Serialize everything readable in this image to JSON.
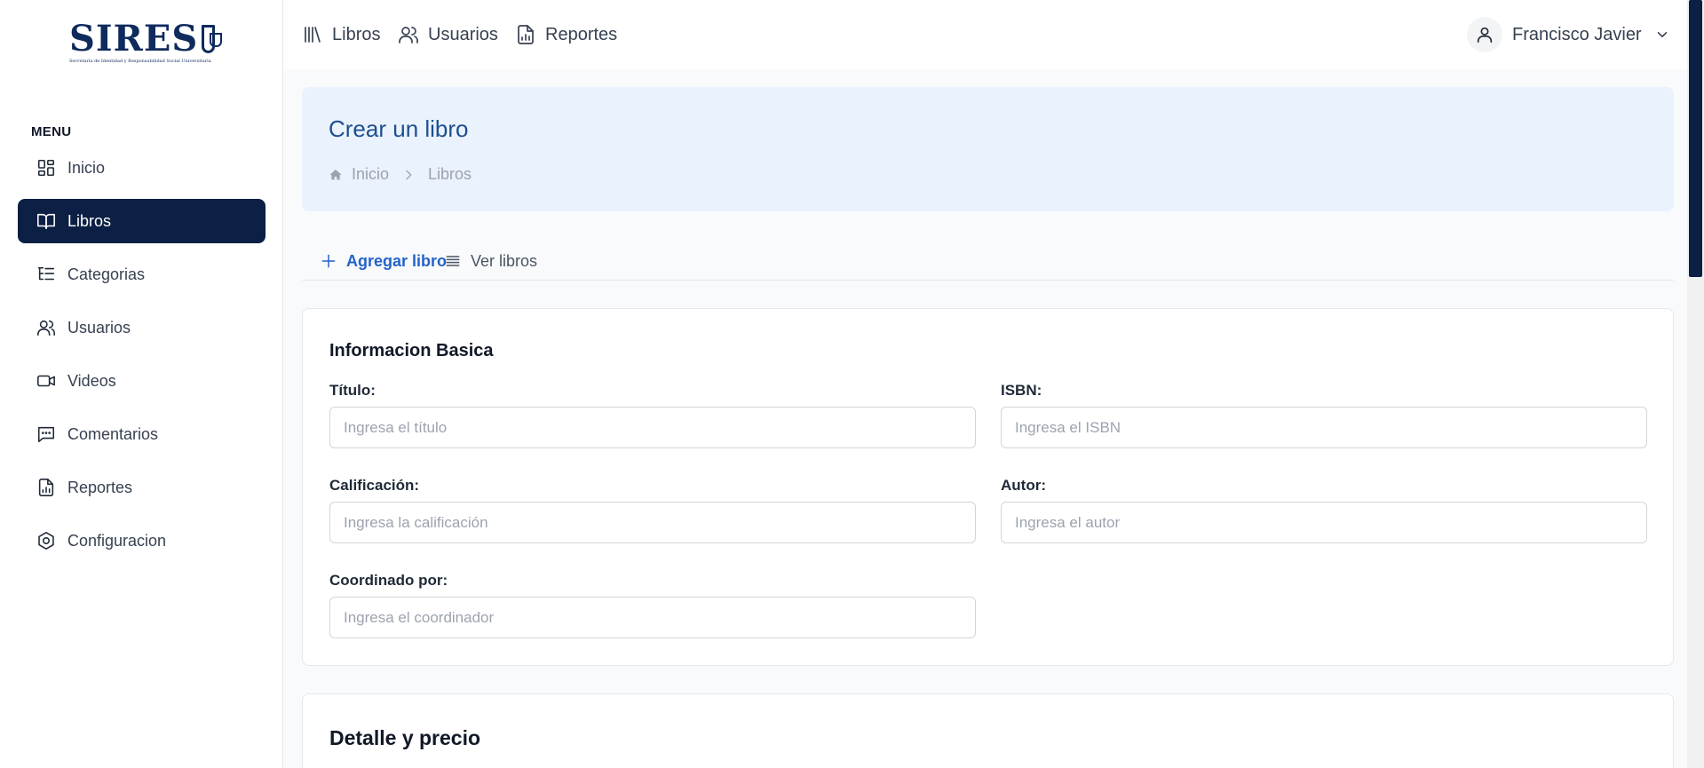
{
  "brand": {
    "logo_text": "SIRES",
    "logo_subtitle": "Secretaría de Identidad y Responsabilidad Social Universitaria"
  },
  "sidebar": {
    "menu_title": "MENU",
    "items": [
      {
        "label": "Inicio",
        "icon": "dashboard-icon",
        "active": false
      },
      {
        "label": "Libros",
        "icon": "book-icon",
        "active": true
      },
      {
        "label": "Categorias",
        "icon": "list-tree-icon",
        "active": false
      },
      {
        "label": "Usuarios",
        "icon": "users-icon",
        "active": false
      },
      {
        "label": "Videos",
        "icon": "video-icon",
        "active": false
      },
      {
        "label": "Comentarios",
        "icon": "comment-icon",
        "active": false
      },
      {
        "label": "Reportes",
        "icon": "report-icon",
        "active": false
      },
      {
        "label": "Configuracion",
        "icon": "settings-icon",
        "active": false
      }
    ]
  },
  "header": {
    "links": [
      {
        "label": "Libros",
        "icon": "library-icon"
      },
      {
        "label": "Usuarios",
        "icon": "users-icon"
      },
      {
        "label": "Reportes",
        "icon": "report-icon"
      }
    ],
    "user_name": "Francisco Javier"
  },
  "banner": {
    "title": "Crear un libro",
    "breadcrumb": [
      "Inicio",
      "Libros"
    ]
  },
  "tabs": [
    {
      "label": "Agregar libro",
      "icon": "plus-icon",
      "active": true
    },
    {
      "label": "Ver libros",
      "icon": "list-icon",
      "active": false
    }
  ],
  "form": {
    "section_title": "Informacion Basica",
    "fields": {
      "titulo": {
        "label": "Título:",
        "placeholder": "Ingresa el título",
        "value": ""
      },
      "isbn": {
        "label": "ISBN:",
        "placeholder": "Ingresa el ISBN",
        "value": ""
      },
      "calificacion": {
        "label": "Calificación:",
        "placeholder": "Ingresa la calificación",
        "value": ""
      },
      "autor": {
        "label": "Autor:",
        "placeholder": "Ingresa el autor",
        "value": ""
      },
      "coordinado": {
        "label": "Coordinado por:",
        "placeholder": "Ingresa el coordinador",
        "value": ""
      }
    }
  },
  "section2": {
    "title": "Detalle y precio"
  },
  "colors": {
    "sidebar_active": "#0c1f44",
    "accent": "#2563c9",
    "banner_bg": "#eaf2fd",
    "banner_title": "#1e4f8f"
  }
}
